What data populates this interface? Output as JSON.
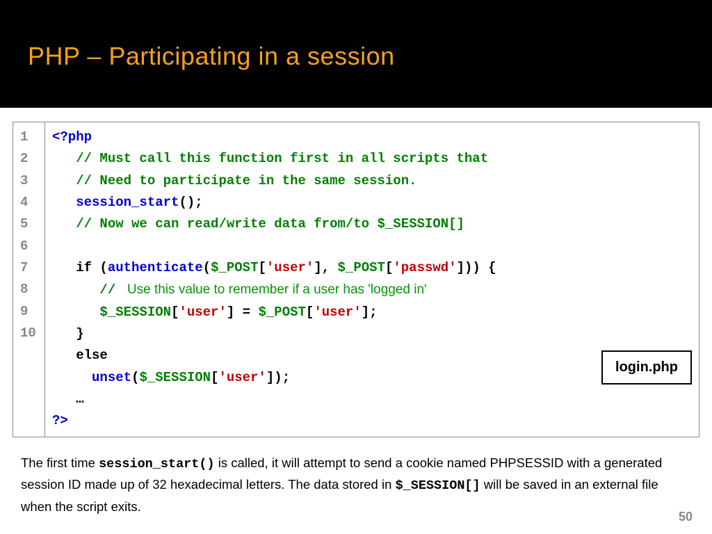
{
  "slide": {
    "title": "PHP – Participating in a session",
    "page_number": "50"
  },
  "code": {
    "line_numbers": "1\n2\n3\n4\n5\n6\n7\n8\n9\n10",
    "label_box": "login.php",
    "l1_open": "<?php",
    "l2_comment": "// Must call this function first in all scripts that",
    "l3_comment": "// Need to participate in the same session.",
    "l4_func": "session_start",
    "l4_paren": "();",
    "l5_comment": "// Now we can read/write data from/to $_SESSION[]",
    "l7_if": "if (",
    "l7_auth": "authenticate",
    "l7_p1": "(",
    "l7_post1": "$_POST",
    "l7_b1": "[",
    "l7_s1": "'user'",
    "l7_b2": "], ",
    "l7_post2": "$_POST",
    "l7_b3": "[",
    "l7_s2": "'passwd'",
    "l7_b4": "])) {",
    "l8_slashes": "// ",
    "l8_text": " Use this value to remember if a user has 'logged in'",
    "l9_sess": "$_SESSION",
    "l9_b1": "[",
    "l9_s1": "'user'",
    "l9_b2": "] = ",
    "l9_post": "$_POST",
    "l9_b3": "[",
    "l9_s2": "'user'",
    "l9_b4": "];",
    "l10_close": "}",
    "l11_else": "else",
    "l12_unset": "unset",
    "l12_p1": "(",
    "l12_sess": "$_SESSION",
    "l12_b1": "[",
    "l12_s1": "'user'",
    "l12_b2": "]);",
    "l13_dots": "…",
    "l14_close": "?>"
  },
  "explain": {
    "t1": "The first time ",
    "m1": "session_start()",
    "t2": " is called, it will attempt to send a cookie named PHPSESSID with a generated session ID made up of 32 hexadecimal letters. The data stored in ",
    "m2": "$_SESSION[]",
    "t3": " will be saved in an external file when the script exits."
  }
}
